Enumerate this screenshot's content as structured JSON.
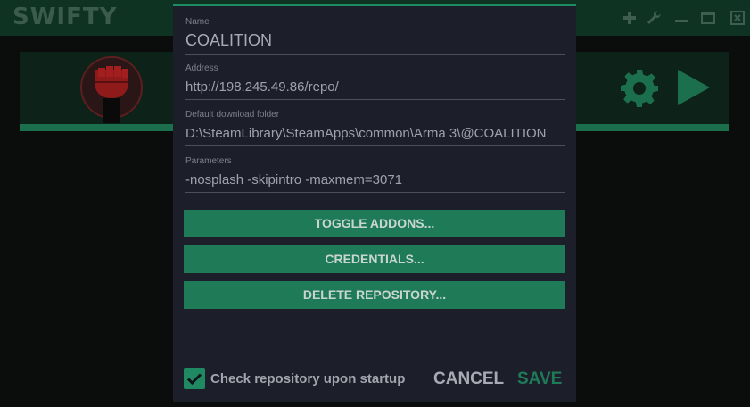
{
  "app": {
    "title": "SWIFTY",
    "icons": {
      "add": "plus-icon",
      "settings": "wrench-icon",
      "minimize": "minimize-icon",
      "maximize": "maximize-icon",
      "close": "close-icon"
    }
  },
  "repo_card": {
    "logo": "raised-fist-logo",
    "settings_icon": "gear-icon",
    "play_icon": "play-icon"
  },
  "dialog": {
    "fields": [
      {
        "label": "Name",
        "value": "COALITION"
      },
      {
        "label": "Address",
        "value": "http://198.245.49.86/repo/"
      },
      {
        "label": "Default download folder",
        "value": "D:\\SteamLibrary\\SteamApps\\common\\Arma 3\\@COALITION"
      },
      {
        "label": "Parameters",
        "value": "-nosplash -skipintro -maxmem=3071"
      }
    ],
    "buttons": {
      "toggle_addons": "TOGGLE ADDONS...",
      "credentials": "CREDENTIALS...",
      "delete_repository": "DELETE REPOSITORY..."
    },
    "check_on_startup": {
      "label": "Check repository upon startup",
      "checked": true
    },
    "cancel_label": "CANCEL",
    "save_label": "SAVE"
  },
  "colors": {
    "accent": "#1f8a62",
    "button": "#1f7a58",
    "dialog_bg": "#1c1f2a",
    "titlebar": "#0f3322"
  }
}
